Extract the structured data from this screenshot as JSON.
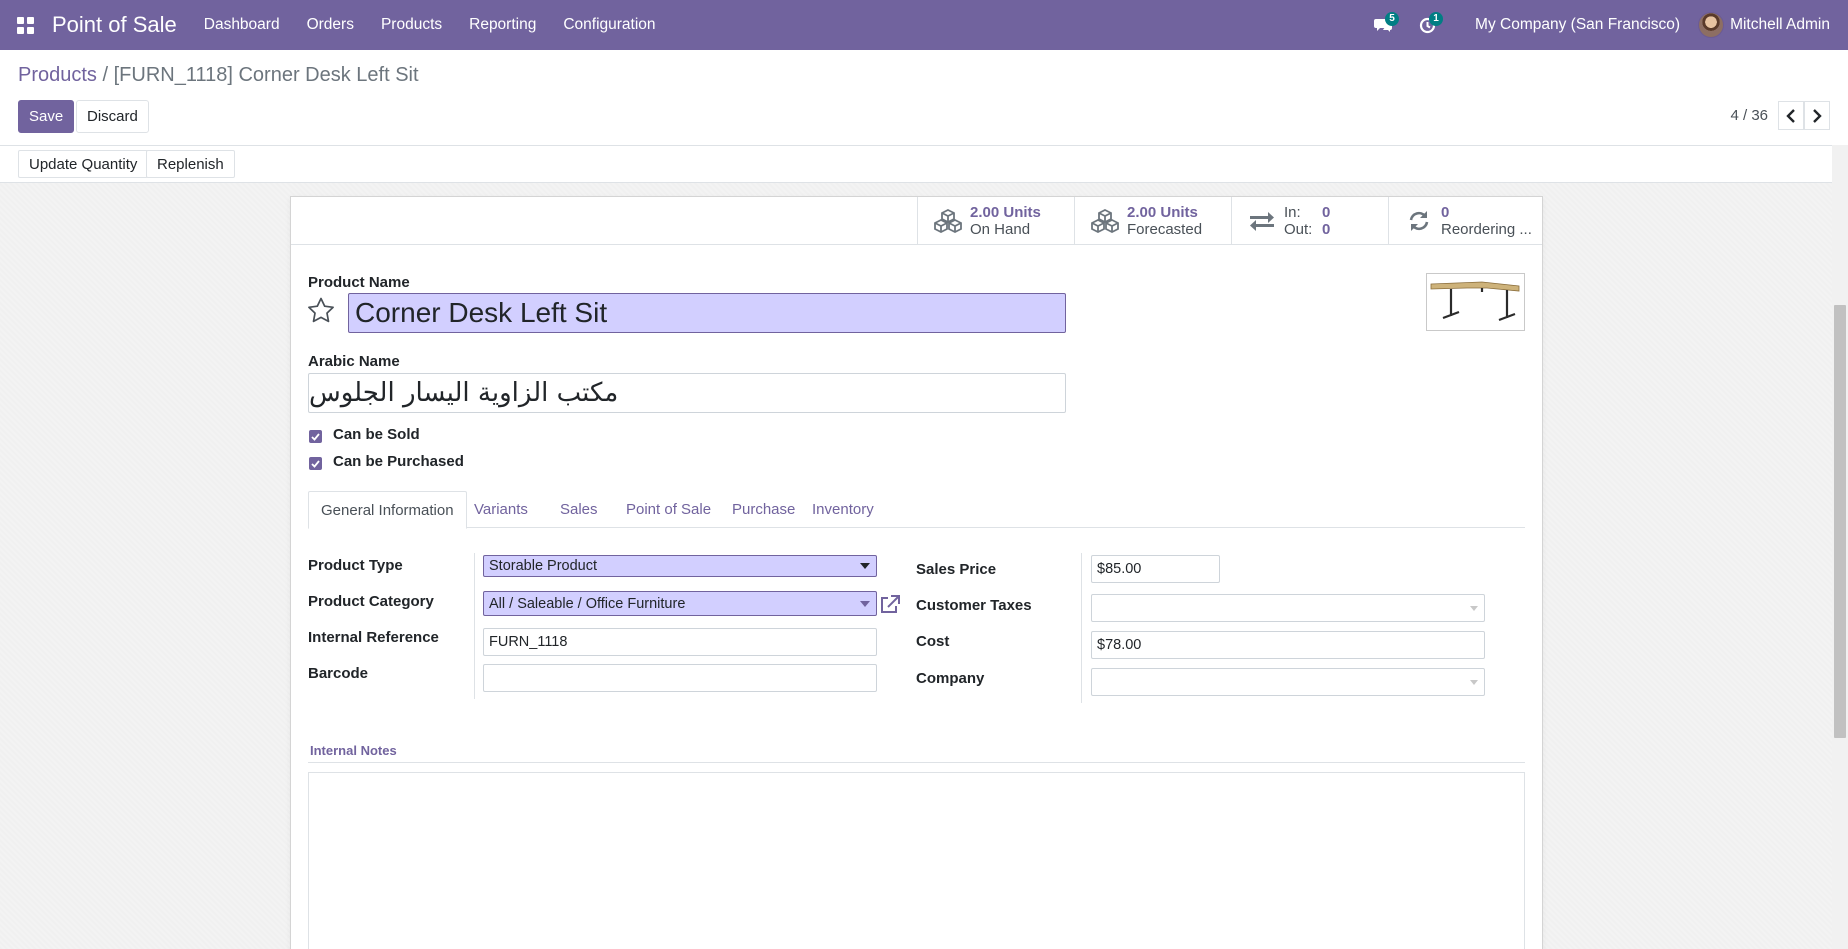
{
  "navbar": {
    "app_title": "Point of Sale",
    "menu": [
      "Dashboard",
      "Orders",
      "Products",
      "Reporting",
      "Configuration"
    ],
    "messages_count": "5",
    "activities_count": "1",
    "company": "My Company (San Francisco)",
    "user": "Mitchell Admin",
    "color": "#71639e"
  },
  "breadcrumb": {
    "parent": "Products",
    "separator": "/",
    "current": "[FURN_1118] Corner Desk Left Sit"
  },
  "actions": {
    "save": "Save",
    "discard": "Discard"
  },
  "pager": {
    "value": "4 / 36"
  },
  "statusbar": {
    "update_quantity": "Update Quantity",
    "replenish": "Replenish"
  },
  "stat_buttons": {
    "on_hand_value": "2.00 Units",
    "on_hand_label": "On Hand",
    "forecasted_value": "2.00 Units",
    "forecasted_label": "Forecasted",
    "in_label": "In:",
    "in_value": "0",
    "out_label": "Out:",
    "out_value": "0",
    "reordering_value": "0",
    "reordering_label": "Reordering ..."
  },
  "form": {
    "product_name_label": "Product Name",
    "product_name": "Corner Desk Left Sit",
    "arabic_name_label": "Arabic Name",
    "arabic_name": "مكتب الزاوية اليسار الجلوس",
    "can_be_sold": "Can be Sold",
    "can_be_purchased": "Can be Purchased"
  },
  "tabs": [
    "General Information",
    "Variants",
    "Sales",
    "Point of Sale",
    "Purchase",
    "Inventory"
  ],
  "general": {
    "product_type_label": "Product Type",
    "product_type": "Storable Product",
    "product_category_label": "Product Category",
    "product_category": "All / Saleable / Office Furniture",
    "internal_reference_label": "Internal Reference",
    "internal_reference": "FURN_1118",
    "barcode_label": "Barcode",
    "barcode": "",
    "sales_price_label": "Sales Price",
    "sales_price": "$85.00",
    "customer_taxes_label": "Customer Taxes",
    "customer_taxes": "",
    "cost_label": "Cost",
    "cost": "$78.00",
    "company_label": "Company",
    "company": ""
  },
  "notes": {
    "title": "Internal Notes"
  }
}
